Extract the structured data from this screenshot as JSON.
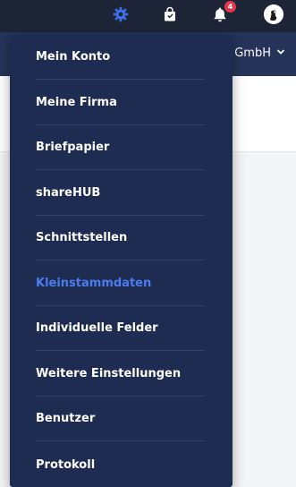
{
  "header": {
    "company_label": "n GmbH",
    "notification_count": "4",
    "icons": {
      "settings": "gear-icon",
      "shop": "shopping-bag-icon",
      "notifications": "bell-icon",
      "profile": "avatar"
    },
    "colors": {
      "topbar": "#1c2436",
      "subbar": "#26345a",
      "accent": "#3b6fe8",
      "badge": "#e5354b"
    }
  },
  "dropdown": {
    "active_item": "Kleinstammdaten",
    "items": [
      {
        "label": "Mein Konto"
      },
      {
        "label": "Meine Firma"
      },
      {
        "label": "Briefpapier"
      },
      {
        "label": "shareHUB"
      },
      {
        "label": "Schnittstellen"
      },
      {
        "label": "Kleinstammdaten"
      },
      {
        "label": "Individuelle Felder"
      },
      {
        "label": "Weitere Einstellungen"
      },
      {
        "label": "Benutzer"
      },
      {
        "label": "Protokoll"
      }
    ]
  }
}
